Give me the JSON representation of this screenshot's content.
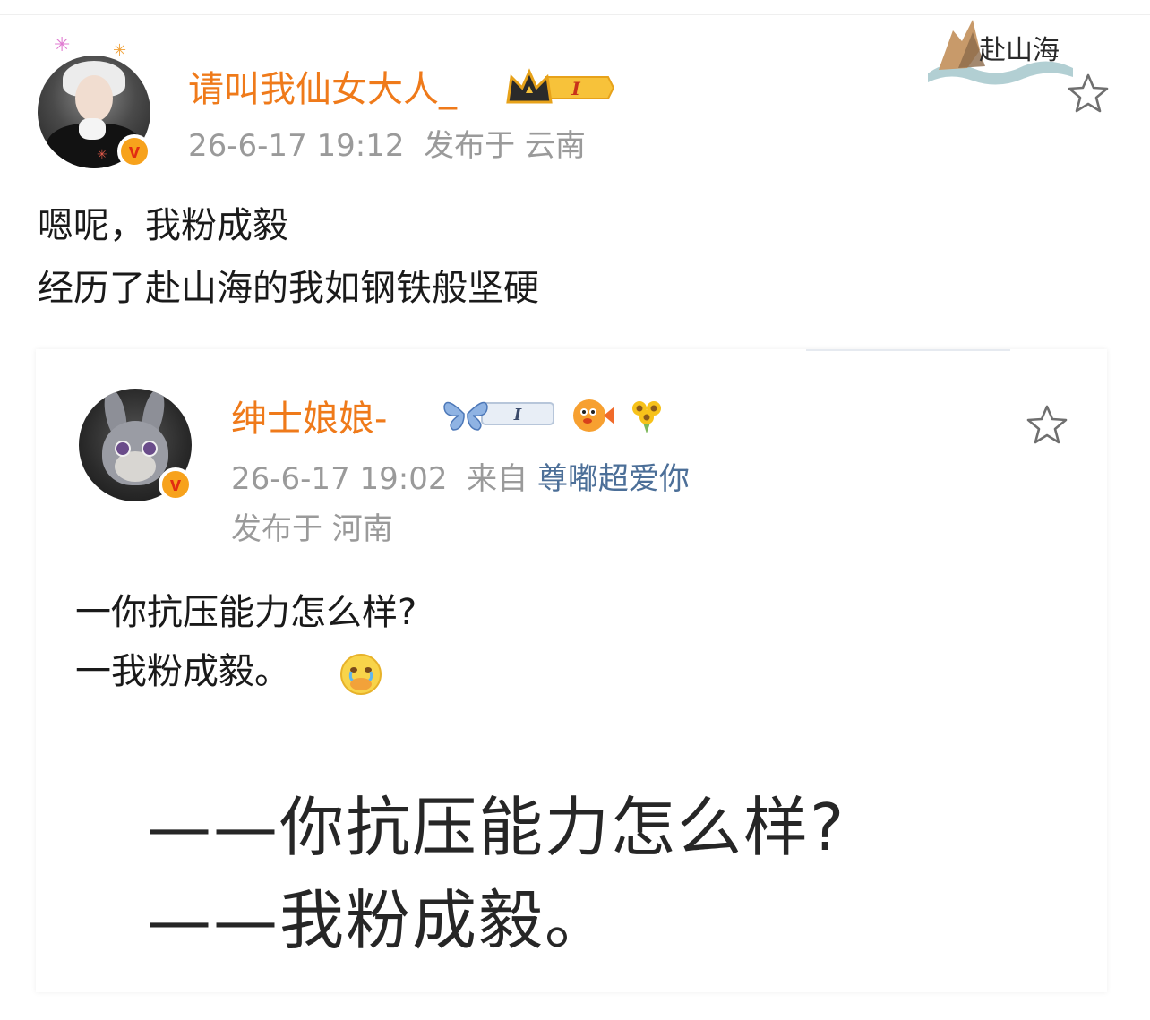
{
  "colors": {
    "username": "#ef7a1a",
    "meta": "#9a9a9a",
    "source_link": "#4c6f98",
    "verified_badge": "#f7a21c",
    "text": "#1a1a1a"
  },
  "post": {
    "username": "请叫我仙女大人_",
    "level_badge": "I",
    "timestamp": "26-6-17 19:12",
    "location": "发布于 云南",
    "verified_icon": "v",
    "body_line1": "嗯呢，我粉成毅",
    "body_line2": "经历了赴山海的我如钢铁般坚硬",
    "topic_logo": "赴山海",
    "favorite_icon": "star-outline-icon"
  },
  "repost": {
    "username": "绅士娘娘-",
    "level_badge": "I",
    "timestamp": "26-6-17 19:02",
    "from_label": "来自",
    "source": "尊嘟超爱你",
    "location": "发布于 河南",
    "verified_icon": "v",
    "body_line1": "一你抗压能力怎么样?",
    "body_line2": "一我粉成毅。",
    "image_line1": "——你抗压能力怎么样?",
    "image_line2": "——我粉成毅。",
    "favorite_icon": "star-outline-icon"
  }
}
